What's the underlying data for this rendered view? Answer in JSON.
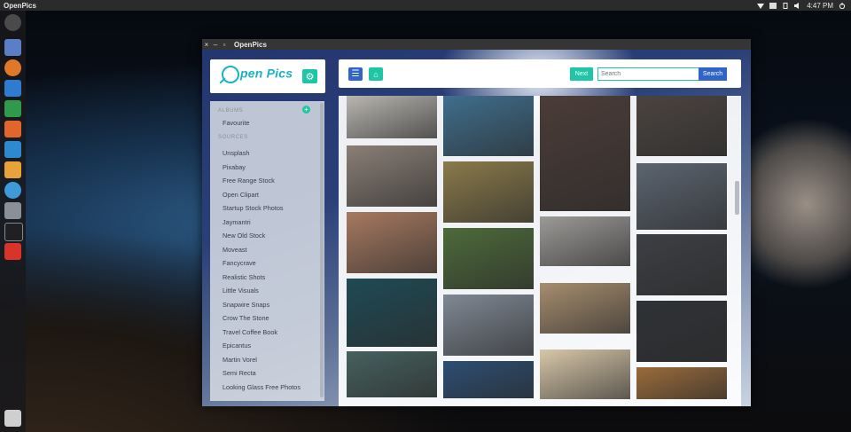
{
  "topbar": {
    "app_name": "OpenPics",
    "time": "4:47 PM",
    "tray_icons": [
      "wifi-icon",
      "keyboard-layout-icon",
      "battery-icon",
      "volume-icon",
      "power-icon"
    ]
  },
  "launcher": {
    "icons": [
      "ubuntu-icon",
      "files-icon",
      "firefox-icon",
      "writer-icon",
      "calc-icon",
      "impress-icon",
      "software-center-icon",
      "amazon-icon",
      "system-settings-icon",
      "screenshot-icon",
      "terminal-icon",
      "openpics-launcher-icon",
      "trash-icon"
    ]
  },
  "window": {
    "title": "OpenPics",
    "controls": {
      "close": "×",
      "minimize": "–",
      "maximize": "▫"
    }
  },
  "brand": {
    "logo_text": "pen Pics",
    "logo_letter": "O",
    "accent": "#1fc6a6",
    "primary": "#2f64c8"
  },
  "sidebar": {
    "albums_label": "ALBUMS",
    "albums": [
      "Favourite"
    ],
    "sources_label": "SOURCES",
    "sources": [
      "Unsplash",
      "Pixabay",
      "Free Range Stock",
      "Open Clipart",
      "Startup Stock Photos",
      "Jaymantri",
      "New Old Stock",
      "Moveast",
      "Fancycrave",
      "Realistic Shots",
      "Little Visuals",
      "Snapwire Snaps",
      "Crow The Stone",
      "Travel Coffee Book",
      "Epicantus",
      "Martin Vorel",
      "Semi Recta",
      "Looking Glass Free Photos"
    ]
  },
  "toolbar": {
    "next_label": "Next",
    "search_placeholder": "Search",
    "search_label": "Search"
  },
  "gallery": {
    "photos": [
      {
        "desc": "hand-drawing-sketch",
        "color": "#b9b6b0"
      },
      {
        "desc": "laptop-on-desk",
        "color": "#8a7f76"
      },
      {
        "desc": "woman-laptop-brick-wall",
        "color": "#a77960"
      },
      {
        "desc": "boat-on-lake-aerial",
        "color": "#1f4a55"
      },
      {
        "desc": "mountain-fjord",
        "color": "#46615e"
      },
      {
        "desc": "hand-holding-phone",
        "color": "#3f6e8d"
      },
      {
        "desc": "people-bending-field",
        "color": "#8a7a4a"
      },
      {
        "desc": "green-hills-landscape",
        "color": "#4d6a3a"
      },
      {
        "desc": "lake-reeds-sunset",
        "color": "#7f8894"
      },
      {
        "desc": "blue-wood-door",
        "color": "#2c4e73"
      },
      {
        "desc": "woman-white-knit-top",
        "color": "#4b3c37"
      },
      {
        "desc": "white-sneaker",
        "color": "#9c9a97"
      },
      {
        "desc": "dog-on-floor",
        "color": "#a68d6e"
      },
      {
        "desc": "lace-fabric",
        "color": "#d8c7a9"
      },
      {
        "desc": "bathtub-pattern-wall",
        "color": "#4a4440"
      },
      {
        "desc": "woman-subway-station",
        "color": "#5b6470"
      },
      {
        "desc": "keyboard-closeup",
        "color": "#3d3f44"
      },
      {
        "desc": "keyboard-closeup-2",
        "color": "#2f3236"
      },
      {
        "desc": "laptop-wooden-table",
        "color": "#9a6b3b"
      }
    ]
  }
}
